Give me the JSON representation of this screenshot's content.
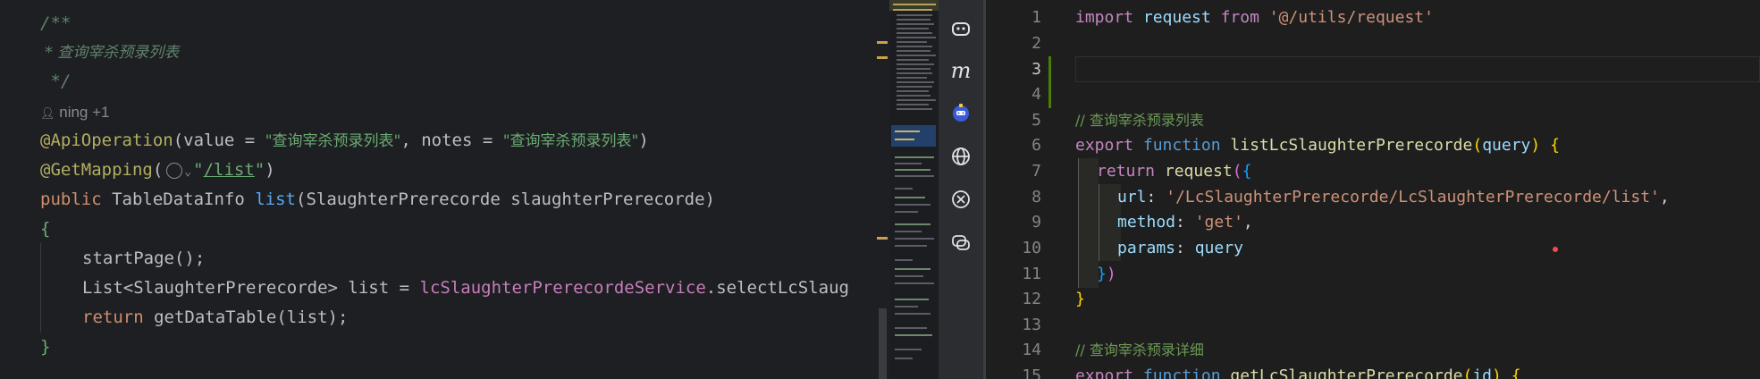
{
  "left_editor": {
    "doc_open": "/**",
    "doc_line": " * 查询宰杀预录列表",
    "doc_close": " */",
    "author_hint": "ning +1",
    "annotation_api": "@ApiOperation",
    "api_value_key": "value = ",
    "api_value": "\"查询宰杀预录列表\"",
    "api_notes_key": ", notes = ",
    "api_notes": "\"查询宰杀预录列表\"",
    "annotation_get": "@GetMapping",
    "get_path_q1": "\"",
    "get_path": "/list",
    "get_path_q2": "\"",
    "sig_public": "public ",
    "sig_type": "TableDataInfo ",
    "sig_method": "list",
    "sig_params": "(SlaughterPrerecorde slaughterPrerecorde)",
    "open_brace": "{",
    "stmt1": "startPage();",
    "stmt2_type": "List<SlaughterPrerecorde> list = ",
    "stmt2_field": "lcSlaughterPrerecordeService",
    "stmt2_call": ".selectLcSlaug",
    "stmt3_kw": "return ",
    "stmt3_call": "getDataTable(list);",
    "close_brace": "}"
  },
  "tool_strip": {
    "icons": [
      "copilot-icon",
      "m-icon",
      "bot-icon",
      "globe-icon",
      "translate-icon",
      "chat-icon"
    ],
    "m_label": "m"
  },
  "right_editor": {
    "line_numbers": [
      "1",
      "2",
      "3",
      "4",
      "5",
      "6",
      "7",
      "8",
      "9",
      "10",
      "11",
      "12",
      "13",
      "14",
      "15"
    ],
    "line1_import": "import ",
    "line1_name": "request ",
    "line1_from": "from ",
    "line1_path": "'@/utils/request'",
    "line5_comment": "// 查询宰杀预录列表",
    "line6_export": "export ",
    "line6_function": "function ",
    "line6_name": "listLcSlaughterPrerecorde",
    "line6_param": "query",
    "line7_return": "return ",
    "line7_call": "request",
    "line8_key": "url",
    "line8_value": "'/LcSlaughterPrerecorde/LcSlaughterPrerecorde/list'",
    "line9_key": "method",
    "line9_value": "'get'",
    "line10_key": "params",
    "line10_value": "query",
    "line14_comment": "// 查询宰杀预录详细",
    "line15_export": "export ",
    "line15_function": "function ",
    "line15_name": "getLcSlaughterPrerecorde",
    "line15_param": "id"
  },
  "colors": {
    "left_bg": "#1e1f22",
    "right_bg": "#1e1e1e",
    "git_added": "#487e02",
    "error_dot": "#f14c4c"
  }
}
